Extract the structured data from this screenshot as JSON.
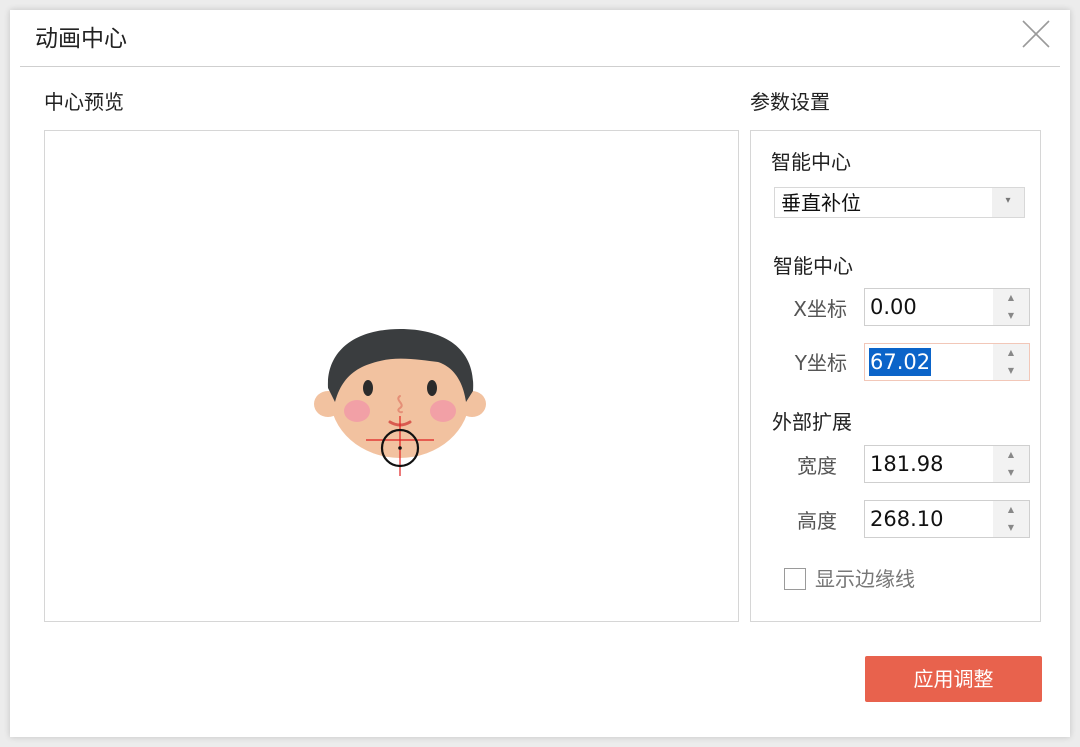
{
  "dialog": {
    "title": "动画中心",
    "close_icon": "close-icon"
  },
  "preview": {
    "label": "中心预览"
  },
  "params": {
    "label": "参数设置",
    "smart_center": {
      "title": "智能中心",
      "select_value": "垂直补位",
      "arrow_icon": "dropdown-arrow-icon"
    },
    "smart_center_coords": {
      "title": "智能中心",
      "x_label": "X坐标",
      "x_value": "0.00",
      "y_label": "Y坐标",
      "y_value": "67.02"
    },
    "external_expand": {
      "title": "外部扩展",
      "width_label": "宽度",
      "width_value": "181.98",
      "height_label": "高度",
      "height_value": "268.10"
    },
    "show_edges": {
      "label": "显示边缘线",
      "checked": false
    }
  },
  "apply_button": {
    "label": "应用调整"
  },
  "colors": {
    "accent": "#e8624d",
    "selection": "#0b64c9",
    "crosshair": "#e02020",
    "hair": "#3a3d3f",
    "skin": "#f2c2a0",
    "cheek": "#f2a0a6"
  }
}
